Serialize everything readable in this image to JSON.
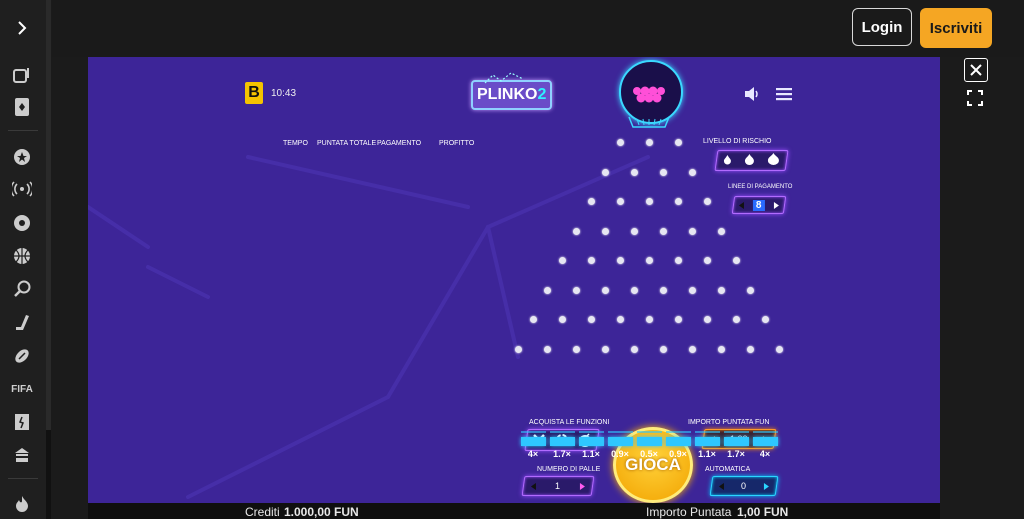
{
  "topbar": {
    "login_label": "Login",
    "signup_label": "Iscriviti"
  },
  "sidebar": {
    "toggle_icon": "chevron-right-icon",
    "fifa_label": "FIFA"
  },
  "game": {
    "brand_badge": "B",
    "time": "10:43",
    "logo_text": "PLINKO",
    "logo_number": "2",
    "columns": {
      "tempo": "TEMPO",
      "puntata_totale": "PUNTATA TOTALE",
      "pagamento": "PAGAMENTO",
      "profitto": "PROFITTO"
    },
    "risk_label": "LIVELLO DI RISCHIO",
    "paylines_label": "LINEE DI PAGAMENTO",
    "paylines_value": "8",
    "multipliers": [
      "4×",
      "1.7×",
      "1.1×",
      "0.9×",
      "0.5×",
      "0.9×",
      "1.1×",
      "1.7×",
      "4×"
    ],
    "buy_features_label": "ACQUISTA LE FUNZIONI",
    "play_label": "GIOCA",
    "bet_label": "IMPORTO PUNTATA FUN",
    "bet_value": "1,00",
    "balls_label": "NUMERO DI PALLE",
    "balls_value": "1",
    "auto_label": "AUTOMATICA",
    "auto_value": "0"
  },
  "footer": {
    "credits_label": "Crediti",
    "credits_value": "1.000,00 FUN",
    "bet_amount_label": "Importo Puntata",
    "bet_amount_value": "1,00 FUN"
  },
  "colors": {
    "game_bg": "#3d2598",
    "accent_orange": "#f5a623",
    "slot_cyan": "#2ec7ff"
  }
}
